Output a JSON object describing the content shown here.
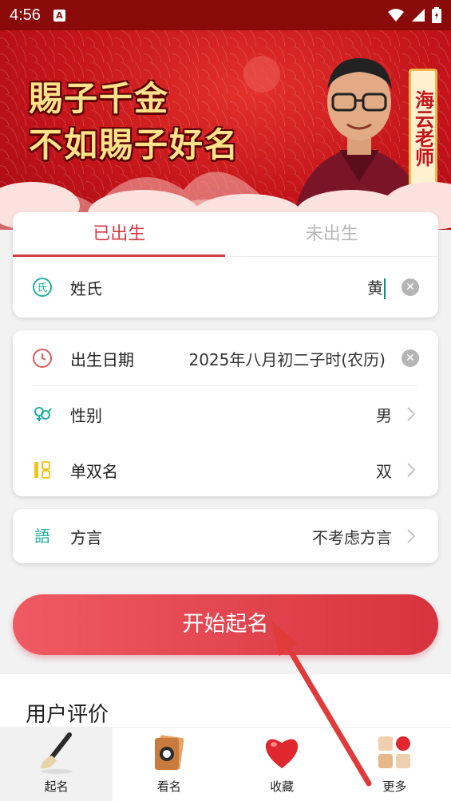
{
  "status_bar": {
    "time": "4:56"
  },
  "banner": {
    "slogan_line1": "賜子千金",
    "slogan_line2": "不如賜子好名",
    "teacher_name": "海云老师"
  },
  "birth_tabs": [
    {
      "label": "已出生",
      "active": true
    },
    {
      "label": "未出生",
      "active": false
    }
  ],
  "surname": {
    "label": "姓氏",
    "value": "黄",
    "icon": "surname-icon"
  },
  "details": {
    "birth_date": {
      "label": "出生日期",
      "value": "2025年八月初二子时(农历)",
      "icon": "clock-icon"
    },
    "gender": {
      "label": "性别",
      "value": "男",
      "icon": "gender-icon"
    },
    "name_length": {
      "label": "单双名",
      "value": "双",
      "icon": "single-double-name-icon"
    }
  },
  "dialect": {
    "label": "方言",
    "value": "不考虑方言",
    "icon": "dialect-icon"
  },
  "start_button": {
    "label": "开始起名"
  },
  "reviews": {
    "title": "用户评价"
  },
  "bottom_nav": [
    {
      "label": "起名",
      "icon": "brush-icon",
      "active": true
    },
    {
      "label": "看名",
      "icon": "scroll-icon",
      "active": false
    },
    {
      "label": "收藏",
      "icon": "heart-icon",
      "active": false
    },
    {
      "label": "更多",
      "icon": "grid-icon",
      "active": false
    }
  ],
  "colors": {
    "accent": "#d53a43",
    "banner_red": "#c4141a",
    "status_bar": "#8a0a0a",
    "teal": "#1fb29a"
  }
}
